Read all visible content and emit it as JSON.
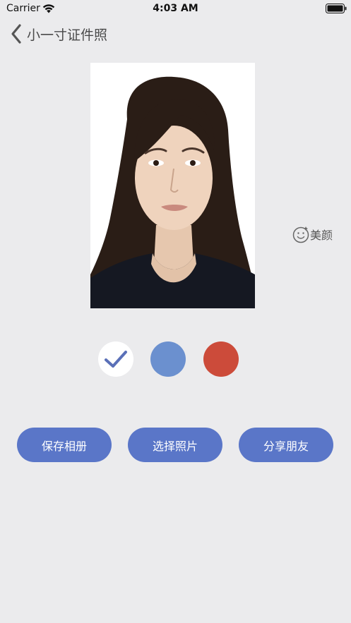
{
  "status_bar": {
    "carrier": "Carrier",
    "time": "4:03 AM"
  },
  "nav": {
    "title": "小一寸证件照",
    "back_icon": "chevron-left-icon"
  },
  "photo": {
    "background_color": "#ffffff"
  },
  "beauty": {
    "label": "美颜",
    "icon": "smiley-face-icon"
  },
  "background_options": [
    {
      "color": "#ffffff",
      "selected": true
    },
    {
      "color": "#6b90cf",
      "selected": false
    },
    {
      "color": "#cc4b3a",
      "selected": false
    }
  ],
  "actions": {
    "save_label": "保存相册",
    "select_label": "选择照片",
    "share_label": "分享朋友"
  },
  "colors": {
    "accent": "#5a76c8",
    "page_background": "#ebebed"
  }
}
